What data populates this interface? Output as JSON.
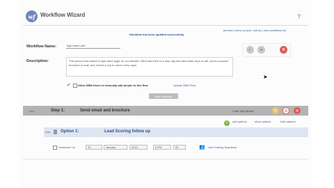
{
  "app": {
    "logo_text": "wf",
    "title": "Workflow Wizard",
    "help_icon": "?"
  },
  "notice": "Workflow has been updated successfully",
  "top_links": "preview  |  show as json, edit as  |  view workflows list",
  "form": {
    "name_label": "Workflow Name:",
    "name_value": "high intent with",
    "description_label": "Description:",
    "description_text": "This person has visited a high value page on our website. We'll add them to a drip, tag and alert sales reps to call, send a product brochure in mail, and remind a rep to call in a few days.",
    "allow_text": "Allow SBM Users to manually add people to this flow",
    "update_link": "Update SBM Flow",
    "save_label": "save workflow"
  },
  "buttons": {
    "btn1": "◐",
    "btn2": "●",
    "btn3": "✕"
  },
  "step": {
    "hide": "hide",
    "label": "Step 1:",
    "name": "Send email and brochure",
    "add_step": "+ Add Step Below",
    "icons": {
      "edit": "✎",
      "stop": "⊘",
      "close": "✕"
    }
  },
  "options": {
    "add_option": "add options",
    "show_options": "show options",
    "hide_options": "hide options",
    "hide": "hide",
    "label": "Option 1:",
    "name": "Lead Scoring follow up"
  },
  "schedule": {
    "checkbox_label": "Schedule? on",
    "day": "25",
    "month": "January",
    "year": "2013",
    "time": "5 PM",
    "minute": "00",
    "segments_link": "Use Existing Segments"
  }
}
